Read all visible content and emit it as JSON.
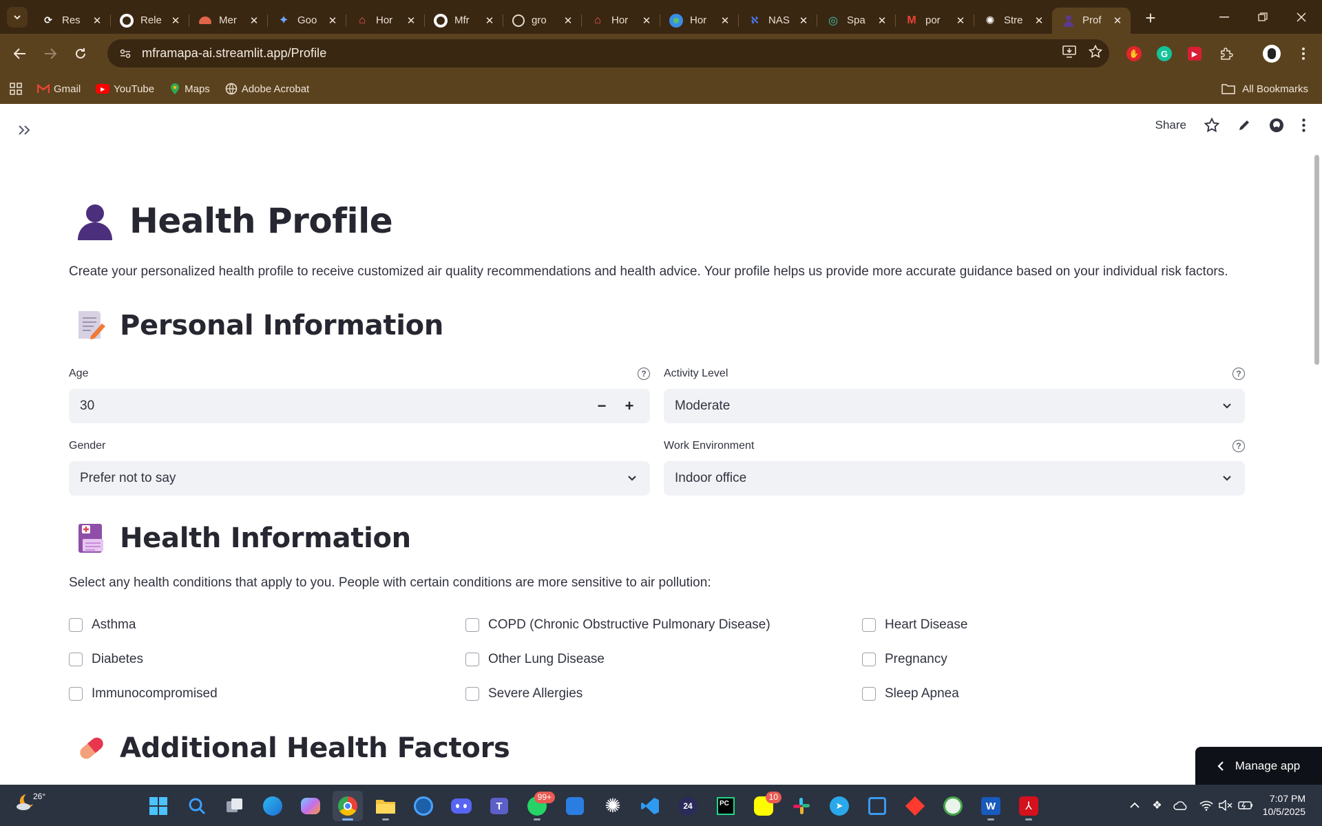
{
  "browser": {
    "tabs": [
      {
        "title": "Res",
        "icon": "refresh-favicon-icon",
        "active": false
      },
      {
        "title": "Rele",
        "icon": "github-favicon-icon",
        "active": false
      },
      {
        "title": "Mer",
        "icon": "helmet-favicon-icon",
        "active": false
      },
      {
        "title": "Goo",
        "icon": "gemini-favicon-icon",
        "active": false
      },
      {
        "title": "Hor",
        "icon": "house-favicon-icon",
        "active": false
      },
      {
        "title": "Mfr",
        "icon": "github-favicon-icon",
        "active": false
      },
      {
        "title": "gro",
        "icon": "globe-favicon-icon",
        "active": false
      },
      {
        "title": "Hor",
        "icon": "house-favicon-icon",
        "active": false
      },
      {
        "title": "Hor",
        "icon": "earth-favicon-icon",
        "active": false
      },
      {
        "title": "NAS",
        "icon": "nasa-favicon-icon",
        "active": false
      },
      {
        "title": "Spa",
        "icon": "spiral-favicon-icon",
        "active": false
      },
      {
        "title": "por",
        "icon": "gmail-favicon-icon",
        "active": false
      },
      {
        "title": "Stre",
        "icon": "openai-favicon-icon",
        "active": false
      },
      {
        "title": "Prof",
        "icon": "person-favicon-icon",
        "active": true
      }
    ],
    "url": "mframapa-ai.streamlit.app/Profile",
    "bookmarks": [
      {
        "label": "Gmail",
        "icon": "gmail-icon"
      },
      {
        "label": "YouTube",
        "icon": "youtube-icon"
      },
      {
        "label": "Maps",
        "icon": "maps-icon"
      },
      {
        "label": "Adobe Acrobat",
        "icon": "globe-icon"
      }
    ],
    "all_bookmarks": "All Bookmarks"
  },
  "header": {
    "share": "Share"
  },
  "page": {
    "title": "Health Profile",
    "intro": "Create your personalized health profile to receive customized air quality recommendations and health advice. Your profile helps us provide more accurate guidance based on your individual risk factors.",
    "personal": {
      "heading": "Personal Information",
      "age_label": "Age",
      "age_value": "30",
      "activity_label": "Activity Level",
      "activity_value": "Moderate",
      "gender_label": "Gender",
      "gender_value": "Prefer not to say",
      "work_label": "Work Environment",
      "work_value": "Indoor office"
    },
    "health": {
      "heading": "Health Information",
      "subtext": "Select any health conditions that apply to you. People with certain conditions are more sensitive to air pollution:",
      "conditions": [
        "Asthma",
        "COPD (Chronic Obstructive Pulmonary Disease)",
        "Heart Disease",
        "Diabetes",
        "Other Lung Disease",
        "Pregnancy",
        "Immunocompromised",
        "Severe Allergies",
        "Sleep Apnea"
      ]
    },
    "additional": {
      "heading": "Additional Health Factors"
    },
    "manage_app": "Manage app"
  },
  "taskbar": {
    "weather_temp": "26°",
    "whatsapp_badge": "99+",
    "snapchat_badge": "10",
    "time": "7:07 PM",
    "date": "10/5/2025"
  }
}
